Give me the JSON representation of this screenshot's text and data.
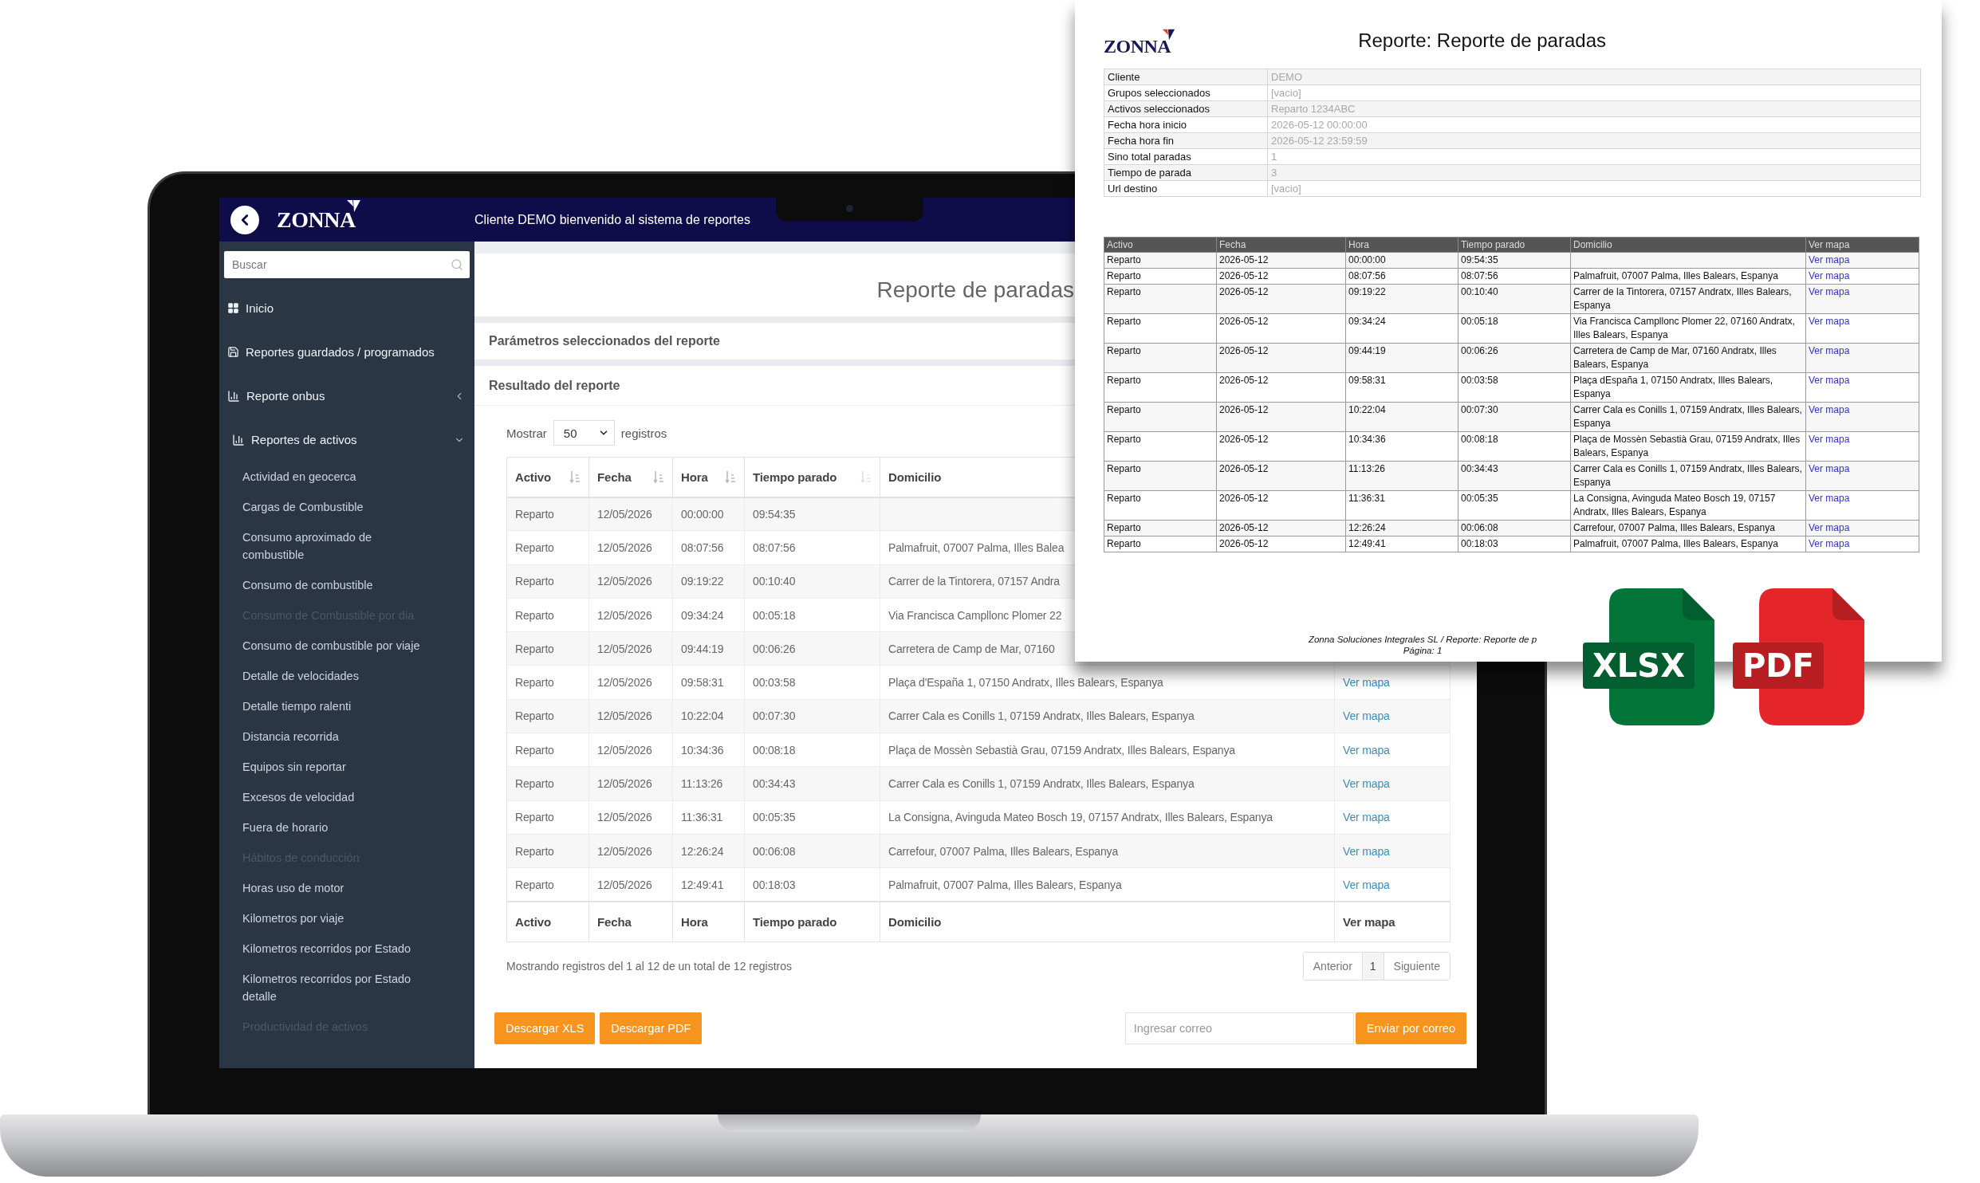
{
  "app": {
    "brand": "ZONNA",
    "welcome": "Cliente DEMO bienvenido al sistema de reportes"
  },
  "sidebar": {
    "search_placeholder": "Buscar",
    "items": [
      {
        "label": "Inicio",
        "kind": "grid"
      },
      {
        "label": "Reportes guardados / programados",
        "kind": "save"
      },
      {
        "label": "Reporte onbus",
        "kind": "chart",
        "expanded": false
      },
      {
        "label": "Reportes de activos",
        "kind": "chart",
        "expanded": true,
        "children": [
          {
            "label": "Actividad en geocerca",
            "disabled": false
          },
          {
            "label": "Cargas de Combustible",
            "disabled": false
          },
          {
            "label": "Consumo aproximado de combustible",
            "disabled": false
          },
          {
            "label": "Consumo de combustible",
            "disabled": false
          },
          {
            "label": "Consumo de Combustible por dia",
            "disabled": true
          },
          {
            "label": "Consumo de combustible por viaje",
            "disabled": false
          },
          {
            "label": "Detalle de velocidades",
            "disabled": false
          },
          {
            "label": "Detalle tiempo ralenti",
            "disabled": false
          },
          {
            "label": "Distancia recorrida",
            "disabled": false
          },
          {
            "label": "Equipos sin reportar",
            "disabled": false
          },
          {
            "label": "Excesos de velocidad",
            "disabled": false
          },
          {
            "label": "Fuera de horario",
            "disabled": false
          },
          {
            "label": "Hábitos de conducción",
            "disabled": true
          },
          {
            "label": "Horas uso de motor",
            "disabled": false
          },
          {
            "label": "Kilometros por viaje",
            "disabled": false
          },
          {
            "label": "Kilometros recorridos por Estado",
            "disabled": false
          },
          {
            "label": "Kilometros recorridos por Estado detalle",
            "disabled": false
          },
          {
            "label": "Productividad de activos",
            "disabled": true
          }
        ]
      }
    ]
  },
  "page": {
    "title": "Reporte de paradas",
    "sections": [
      "Parámetros seleccionados del reporte",
      "Resultado del reporte"
    ]
  },
  "length_menu": {
    "prefix": "Mostrar",
    "value": "50",
    "suffix": "registros"
  },
  "table": {
    "columns": [
      {
        "label": "Activo",
        "kind": "sortable",
        "sorted": true
      },
      {
        "label": "Fecha",
        "kind": "sortable",
        "sorted": true
      },
      {
        "label": "Hora",
        "kind": "sortable",
        "sorted": true
      },
      {
        "label": "Tiempo parado",
        "kind": "sortable",
        "sorted": false
      },
      {
        "label": "Domicilio",
        "kind": "plain"
      }
    ],
    "rows": [
      {
        "activo": "Reparto",
        "fecha": "12/05/2026",
        "hora": "00:00:00",
        "tiempo": "09:54:35"
      },
      {
        "activo": "Reparto",
        "fecha": "12/05/2026",
        "hora": "08:07:56",
        "tiempo": "08:07:56",
        "domicilio": "Palmafruit, 07007 Palma, Illes Balea"
      },
      {
        "activo": "Reparto",
        "fecha": "12/05/2026",
        "hora": "09:19:22",
        "tiempo": "00:10:40",
        "domicilio": "Carrer de la Tintorera, 07157 Andra"
      },
      {
        "activo": "Reparto",
        "fecha": "12/05/2026",
        "hora": "09:34:24",
        "tiempo": "00:05:18",
        "domicilio": "Via Francisca Campllonc Plomer 22"
      },
      {
        "activo": "Reparto",
        "fecha": "12/05/2026",
        "hora": "09:44:19",
        "tiempo": "00:06:26",
        "domicilio": "Carretera de Camp de Mar, 07160"
      },
      {
        "activo": "Reparto",
        "fecha": "12/05/2026",
        "hora": "09:58:31",
        "tiempo": "00:03:58",
        "domicilio": "Plaça d'España 1, 07150 Andratx, Illes Balears, Espanya",
        "link": "Ver mapa"
      },
      {
        "activo": "Reparto",
        "fecha": "12/05/2026",
        "hora": "10:22:04",
        "tiempo": "00:07:30",
        "domicilio": "Carrer Cala es Conills 1, 07159 Andratx, Illes Balears, Espanya",
        "link": "Ver mapa"
      },
      {
        "activo": "Reparto",
        "fecha": "12/05/2026",
        "hora": "10:34:36",
        "tiempo": "00:08:18",
        "domicilio": "Plaça de Mossèn Sebastià Grau, 07159 Andratx, Illes Balears, Espanya",
        "link": "Ver mapa"
      },
      {
        "activo": "Reparto",
        "fecha": "12/05/2026",
        "hora": "11:13:26",
        "tiempo": "00:34:43",
        "domicilio": "Carrer Cala es Conills 1, 07159 Andratx, Illes Balears, Espanya",
        "link": "Ver mapa"
      },
      {
        "activo": "Reparto",
        "fecha": "12/05/2026",
        "hora": "11:36:31",
        "tiempo": "00:05:35",
        "domicilio": "La Consigna, Avinguda Mateo Bosch 19, 07157 Andratx, Illes Balears, Espanya",
        "link": "Ver mapa"
      },
      {
        "activo": "Reparto",
        "fecha": "12/05/2026",
        "hora": "12:26:24",
        "tiempo": "00:06:08",
        "domicilio": "Carrefour, 07007 Palma, Illes Balears, Espanya",
        "link": "Ver mapa"
      },
      {
        "activo": "Reparto",
        "fecha": "12/05/2026",
        "hora": "12:49:41",
        "tiempo": "00:18:03",
        "domicilio": "Palmafruit, 07007 Palma, Illes Balears, Espanya",
        "link": "Ver mapa"
      }
    ],
    "footer": [
      "Activo",
      "Fecha",
      "Hora",
      "Tiempo parado",
      "Domicilio",
      "Ver mapa"
    ]
  },
  "info": "Mostrando registros del 1 al 12 de un total de 12 registros",
  "pagination": [
    {
      "label": "Anterior",
      "selected": false
    },
    {
      "label": "1",
      "selected": true
    },
    {
      "label": "Siguiente",
      "selected": false
    }
  ],
  "actions": {
    "buttons": [
      "Descargar XLS",
      "Descargar PDF"
    ],
    "email_placeholder": "Ingresar correo",
    "send": "Enviar por correo"
  },
  "pdf": {
    "brand": "ZONNA",
    "title": "Reporte: Reporte de paradas",
    "params": [
      {
        "label": "Cliente",
        "value": "DEMO"
      },
      {
        "label": "Grupos seleccionados",
        "value": "[vacio]"
      },
      {
        "label": "Activos seleccionados",
        "value": "Reparto 1234ABC"
      },
      {
        "label": "Fecha hora inicio",
        "value": "2026-05-12 00:00:00"
      },
      {
        "label": "Fecha hora fin",
        "value": "2026-05-12 23:59:59"
      },
      {
        "label": "Sino total paradas",
        "value": "1"
      },
      {
        "label": "Tiempo de parada",
        "value": "3"
      },
      {
        "label": "Url destino",
        "value": "[vacio]"
      }
    ],
    "columns": [
      "Activo",
      "Fecha",
      "Hora",
      "Tiempo parado",
      "Domicilio",
      "Ver mapa"
    ],
    "rows": [
      [
        "Reparto",
        "2026-05-12",
        "00:00:00",
        "09:54:35",
        "",
        "Ver mapa"
      ],
      [
        "Reparto",
        "2026-05-12",
        "08:07:56",
        "08:07:56",
        "Palmafruit, 07007 Palma, Illes Balears, Espanya",
        "Ver mapa"
      ],
      [
        "Reparto",
        "2026-05-12",
        "09:19:22",
        "00:10:40",
        "Carrer de la Tintorera, 07157 Andratx, Illes Balears, Espanya",
        "Ver mapa"
      ],
      [
        "Reparto",
        "2026-05-12",
        "09:34:24",
        "00:05:18",
        "Via Francisca Campllonc Plomer 22, 07160 Andratx, Illes Balears, Espanya",
        "Ver mapa"
      ],
      [
        "Reparto",
        "2026-05-12",
        "09:44:19",
        "00:06:26",
        "Carretera de Camp de Mar, 07160 Andratx, Illes Balears, Espanya",
        "Ver mapa"
      ],
      [
        "Reparto",
        "2026-05-12",
        "09:58:31",
        "00:03:58",
        "Plaça dEspaña 1, 07150 Andratx, Illes Balears, Espanya",
        "Ver mapa"
      ],
      [
        "Reparto",
        "2026-05-12",
        "10:22:04",
        "00:07:30",
        "Carrer Cala es Conills 1, 07159 Andratx, Illes Balears, Espanya",
        "Ver mapa"
      ],
      [
        "Reparto",
        "2026-05-12",
        "10:34:36",
        "00:08:18",
        "Plaça de Mossèn Sebastià Grau, 07159 Andratx, Illes Balears, Espanya",
        "Ver mapa"
      ],
      [
        "Reparto",
        "2026-05-12",
        "11:13:26",
        "00:34:43",
        "Carrer Cala es Conills 1, 07159 Andratx, Illes Balears, Espanya",
        "Ver mapa"
      ],
      [
        "Reparto",
        "2026-05-12",
        "11:36:31",
        "00:05:35",
        "La Consigna, Avinguda Mateo Bosch 19, 07157 Andratx, Illes Balears, Espanya",
        "Ver mapa"
      ],
      [
        "Reparto",
        "2026-05-12",
        "12:26:24",
        "00:06:08",
        "Carrefour, 07007 Palma, Illes Balears, Espanya",
        "Ver mapa"
      ],
      [
        "Reparto",
        "2026-05-12",
        "12:49:41",
        "00:18:03",
        "Palmafruit, 07007 Palma, Illes Balears, Espanya",
        "Ver mapa"
      ]
    ],
    "footer": "Zonna Soluciones Integrales SL / Reporte: Reporte de p",
    "page": "Página: 1"
  },
  "export_icons": [
    {
      "label": "XLSX",
      "color": "#037539"
    },
    {
      "label": "PDF",
      "color": "#e4262b"
    }
  ]
}
